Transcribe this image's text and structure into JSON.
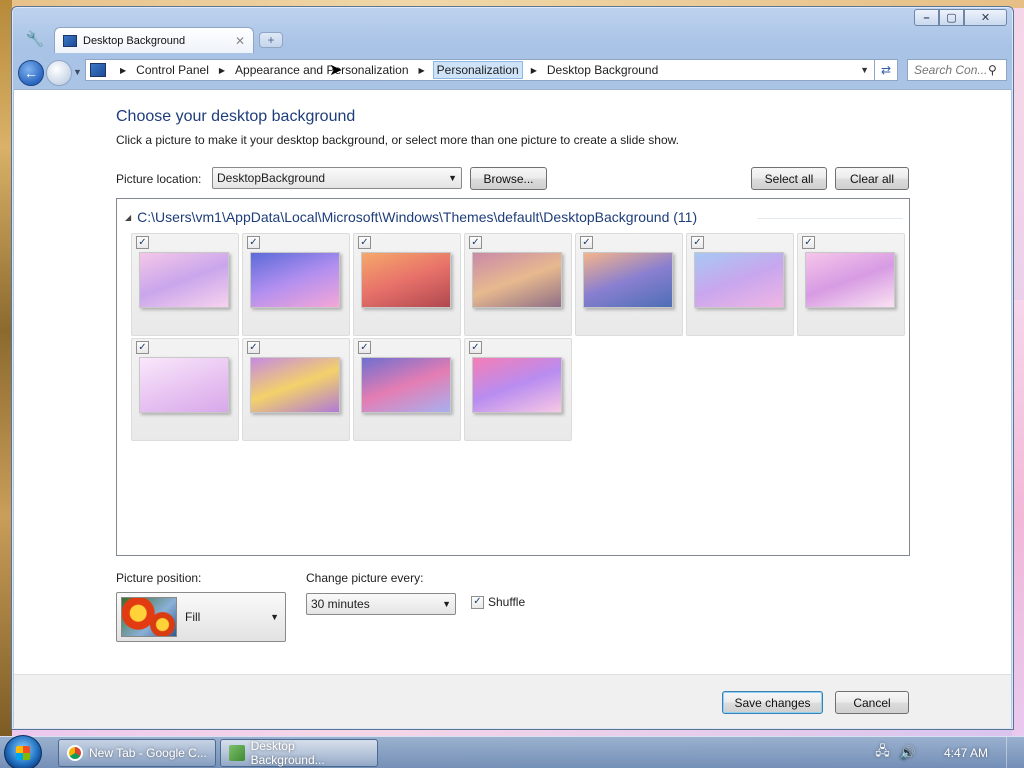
{
  "window": {
    "tab_title": "Desktop Background",
    "tab_icon": "control-panel-icon",
    "controls": {
      "minimize": "–",
      "maximize": "▢",
      "close": "✕"
    }
  },
  "address_bar": {
    "breadcrumbs": [
      "Control Panel",
      "Appearance and Personalization",
      "Personalization",
      "Desktop Background"
    ],
    "active_crumb": "Personalization",
    "search_placeholder": "Search Con..."
  },
  "main": {
    "title": "Choose your desktop background",
    "description": "Click a picture to make it your desktop background, or select more than one picture to create a slide show.",
    "picture_location_label": "Picture location:",
    "picture_location_value": "DesktopBackground",
    "browse_label": "Browse...",
    "select_all_label": "Select all",
    "clear_all_label": "Clear all",
    "group_header": "C:\\Users\\vm1\\AppData\\Local\\Microsoft\\Windows\\Themes\\default\\DesktopBackground (11)",
    "thumbnails": [
      {
        "name": "thumb-1",
        "checked": true,
        "colors": [
          "#f4c7e8",
          "#c9a6ec",
          "#f7d2ee"
        ]
      },
      {
        "name": "thumb-2",
        "checked": true,
        "colors": [
          "#5b6bd8",
          "#b28ff0",
          "#f5a7d6"
        ]
      },
      {
        "name": "thumb-3",
        "checked": true,
        "colors": [
          "#f5a96a",
          "#e7716a",
          "#b0484f"
        ]
      },
      {
        "name": "thumb-4",
        "checked": true,
        "colors": [
          "#c98aa8",
          "#e7b98f",
          "#8f6f86"
        ]
      },
      {
        "name": "thumb-5",
        "checked": true,
        "colors": [
          "#f5b58a",
          "#8a7fd0",
          "#4d6fb5"
        ]
      },
      {
        "name": "thumb-6",
        "checked": true,
        "colors": [
          "#a7c8f2",
          "#c8a6ee",
          "#efb6e4"
        ]
      },
      {
        "name": "thumb-7",
        "checked": true,
        "colors": [
          "#f5c6ea",
          "#d79be3",
          "#f9e2f2"
        ]
      },
      {
        "name": "thumb-8",
        "checked": true,
        "colors": [
          "#f9e8fb",
          "#e9c6f2",
          "#d8a8ea"
        ]
      },
      {
        "name": "thumb-9",
        "checked": true,
        "colors": [
          "#c58be0",
          "#f3d16a",
          "#b07ad6"
        ]
      },
      {
        "name": "thumb-10",
        "checked": true,
        "colors": [
          "#6e6fd0",
          "#e47db3",
          "#a7b0ef"
        ]
      },
      {
        "name": "thumb-11",
        "checked": true,
        "colors": [
          "#f57eb6",
          "#b88cf0",
          "#f7c8e5"
        ]
      }
    ],
    "picture_position_label": "Picture position:",
    "picture_position_value": "Fill",
    "change_picture_label": "Change picture every:",
    "change_picture_value": "30 minutes",
    "shuffle_label": "Shuffle",
    "shuffle_checked": true
  },
  "footer": {
    "save_label": "Save changes",
    "cancel_label": "Cancel"
  },
  "taskbar": {
    "items": [
      {
        "label": "New Tab - Google C...",
        "icon": "chrome-icon"
      },
      {
        "label": "Desktop Background...",
        "icon": "control-panel-icon"
      }
    ],
    "clock": "4:47 AM"
  }
}
